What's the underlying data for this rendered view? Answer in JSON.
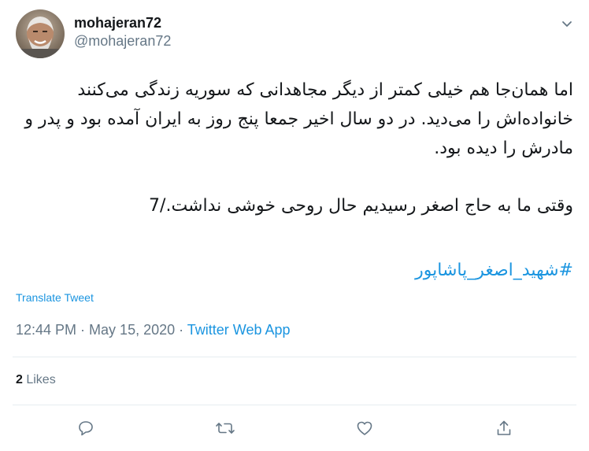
{
  "user": {
    "display_name": "mohajeran72",
    "handle": "@mohajeran72"
  },
  "tweet": {
    "paragraph1": "اما همان‌جا هم خیلی کمتر از دیگر مجاهدانی که سوریه زندگی می‌کنند خانواده‌اش را می‌دید. در دو سال اخیر جمعا پنج روز به ایران آمده بود و پدر و مادرش را دیده بود.",
    "paragraph2": "وقتی ما به حاج اصغر رسیدیم حال روحی خوشی نداشت./7",
    "hashtag": "#شهید_اصغر_پاشاپور"
  },
  "translate_label": "Translate Tweet",
  "meta": {
    "time": "12:44 PM",
    "separator1": " · ",
    "date": "May 15, 2020",
    "separator2": " · ",
    "source": "Twitter Web App"
  },
  "likes": {
    "count": "2",
    "label": " Likes"
  },
  "icons": {
    "caret": "chevron-down-icon",
    "reply": "reply-icon",
    "retweet": "retweet-icon",
    "like": "heart-icon",
    "share": "share-icon"
  },
  "colors": {
    "text": "#14171a",
    "secondary": "#657786",
    "link": "#1b95e0",
    "divider": "#e6ecf0"
  }
}
